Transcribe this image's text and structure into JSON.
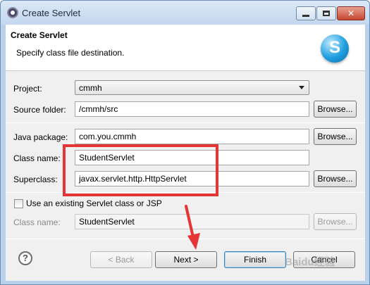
{
  "window": {
    "title": "Create Servlet",
    "controls": {
      "minimize": "minimize",
      "maximize": "maximize",
      "close": "✕"
    }
  },
  "header": {
    "title": "Create Servlet",
    "subtitle": "Specify class file destination.",
    "logo_letter": "S"
  },
  "form": {
    "project": {
      "label": "Project:",
      "value": "cmmh"
    },
    "source_folder": {
      "label": "Source folder:",
      "value": "/cmmh/src",
      "browse": "Browse..."
    },
    "java_package": {
      "label": "Java package:",
      "value": "com.you.cmmh",
      "browse": "Browse..."
    },
    "class_name": {
      "label": "Class name:",
      "value": "StudentServlet"
    },
    "superclass": {
      "label": "Superclass:",
      "value": "javax.servlet.http.HttpServlet",
      "browse": "Browse..."
    },
    "use_existing": {
      "label": "Use an existing Servlet class or JSP",
      "checked": false
    },
    "existing_class_name": {
      "label": "Class name:",
      "value": "StudentServlet",
      "browse": "Browse..."
    }
  },
  "footer": {
    "help_symbol": "?",
    "back_label": "< Back",
    "next_label": "Next >",
    "finish_label": "Finish",
    "cancel_label": "Cancel"
  },
  "annotation": {
    "highlight_color": "#e53535"
  },
  "watermark": "Baidu经验"
}
